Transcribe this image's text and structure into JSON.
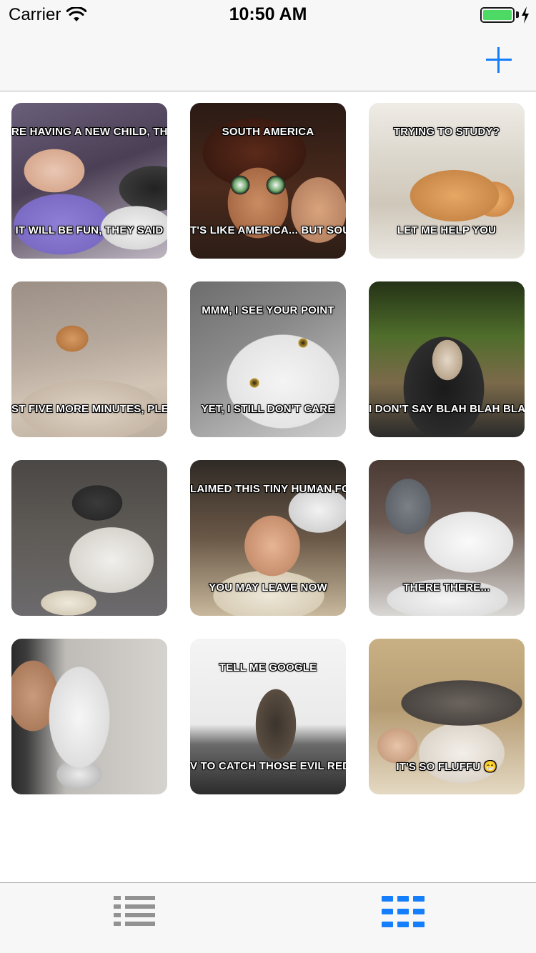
{
  "status_bar": {
    "carrier": "Carrier",
    "time": "10:50 AM",
    "battery_level": 1.0,
    "battery_color": "#4cd964"
  },
  "nav_bar": {
    "add_icon": "plus-icon",
    "accent_color": "#147efb"
  },
  "memes": [
    {
      "top_text": "RE HAVING A NEW CHILD, THEY",
      "bottom_text": "IT WILL BE FUN, THEY SAID"
    },
    {
      "top_text": "SOUTH AMERICA",
      "bottom_text": "T'S LIKE AMERICA... BUT SOUTH"
    },
    {
      "top_text": "TRYING TO STUDY?",
      "bottom_text": "LET ME HELP YOU"
    },
    {
      "top_text": "",
      "bottom_text": "ST FIVE MORE MINUTES, PLEAS"
    },
    {
      "top_text": "MMM, I SEE YOUR POINT",
      "bottom_text": "YET, I STILL DON'T CARE"
    },
    {
      "top_text": "",
      "bottom_text": "I DON'T SAY BLAH BLAH BLAH"
    },
    {
      "top_text": "",
      "bottom_text": ""
    },
    {
      "top_text": "LAIMED THIS TINY HUMAN FOR",
      "bottom_text": "YOU MAY LEAVE NOW"
    },
    {
      "top_text": "",
      "bottom_text": "THERE THERE..."
    },
    {
      "top_text": "",
      "bottom_text": ""
    },
    {
      "top_text": "TELL ME GOOGLE",
      "bottom_text": "V TO CATCH THOSE EVIL RED DO"
    },
    {
      "top_text": "",
      "bottom_text": "IT'S SO FLUFFU 😁"
    }
  ],
  "tab_bar": {
    "tabs": [
      {
        "icon": "list-icon",
        "selected": false
      },
      {
        "icon": "grid-icon",
        "selected": true
      }
    ],
    "inactive_color": "#929292",
    "active_color": "#147efb"
  }
}
